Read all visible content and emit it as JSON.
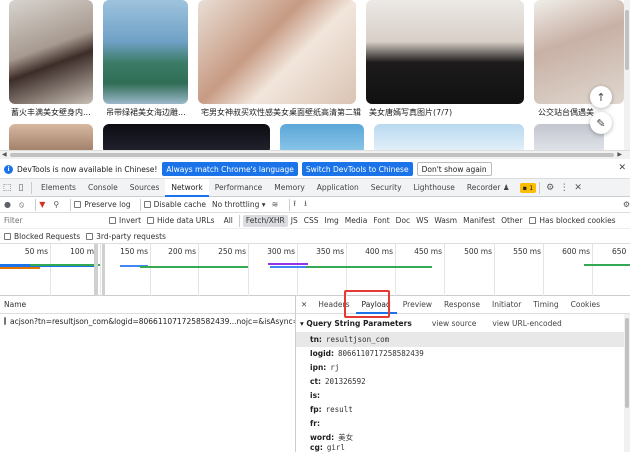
{
  "gallery": {
    "captions": [
      "蓄火丰满美女壁身内...",
      "吊带绿裙美女海边雕...",
      "宅男女神叔买欢性感美女桌面壁纸高清第二辑",
      "美女唐嫣写真图片(7/7)",
      "公交站台偶遇美"
    ]
  },
  "infobar": {
    "message": "DevTools is now available in Chinese!",
    "btn_match": "Always match Chrome's language",
    "btn_switch": "Switch DevTools to Chinese",
    "btn_dont_show": "Don't show again"
  },
  "devtools_tabs": [
    "Elements",
    "Console",
    "Sources",
    "Network",
    "Performance",
    "Memory",
    "Application",
    "Security",
    "Lighthouse",
    "Recorder ♟"
  ],
  "active_tab": "Network",
  "issues_badge": "1",
  "toolbar": {
    "preserve_log": "Preserve log",
    "disable_cache": "Disable cache",
    "throttling": "No throttling"
  },
  "filter": {
    "placeholder": "Filter",
    "invert": "Invert",
    "hide_data_urls": "Hide data URLs",
    "types": [
      "All",
      "Fetch/XHR",
      "JS",
      "CSS",
      "Img",
      "Media",
      "Font",
      "Doc",
      "WS",
      "Wasm",
      "Manifest",
      "Other"
    ],
    "active_type": "Fetch/XHR",
    "blocked_cookies": "Has blocked cookies",
    "blocked_requests": "Blocked Requests",
    "third_party": "3rd-party requests"
  },
  "timeline": {
    "ticks": [
      "50 ms",
      "100 ms",
      "150 ms",
      "200 ms",
      "250 ms",
      "300 ms",
      "350 ms",
      "400 ms",
      "450 ms",
      "500 ms",
      "550 ms",
      "600 ms",
      "650"
    ]
  },
  "requests": {
    "name_header": "Name",
    "rows": [
      "acjson?tn=resultjson_com&logid=8066110717258582439...nojc=&isAsync=&pn..."
    ]
  },
  "detail_tabs": [
    "Headers",
    "Payload",
    "Preview",
    "Response",
    "Initiator",
    "Timing",
    "Cookies"
  ],
  "active_detail_tab": "Payload",
  "query": {
    "title": "▾ Query String Parameters",
    "view_source": "view source",
    "view_url_encoded": "view URL-encoded",
    "params": [
      {
        "k": "tn:",
        "v": "resultjson_com"
      },
      {
        "k": "logid:",
        "v": "8066110717258582439"
      },
      {
        "k": "ipn:",
        "v": "rj"
      },
      {
        "k": "ct:",
        "v": "201326592"
      },
      {
        "k": "is:",
        "v": ""
      },
      {
        "k": "fp:",
        "v": "result"
      },
      {
        "k": "fr:",
        "v": ""
      },
      {
        "k": "word:",
        "v": "美女"
      },
      {
        "k": "cg:",
        "v": "girl"
      }
    ]
  },
  "colors": {
    "accent": "#1a73e8",
    "highlight": "#e53935"
  }
}
